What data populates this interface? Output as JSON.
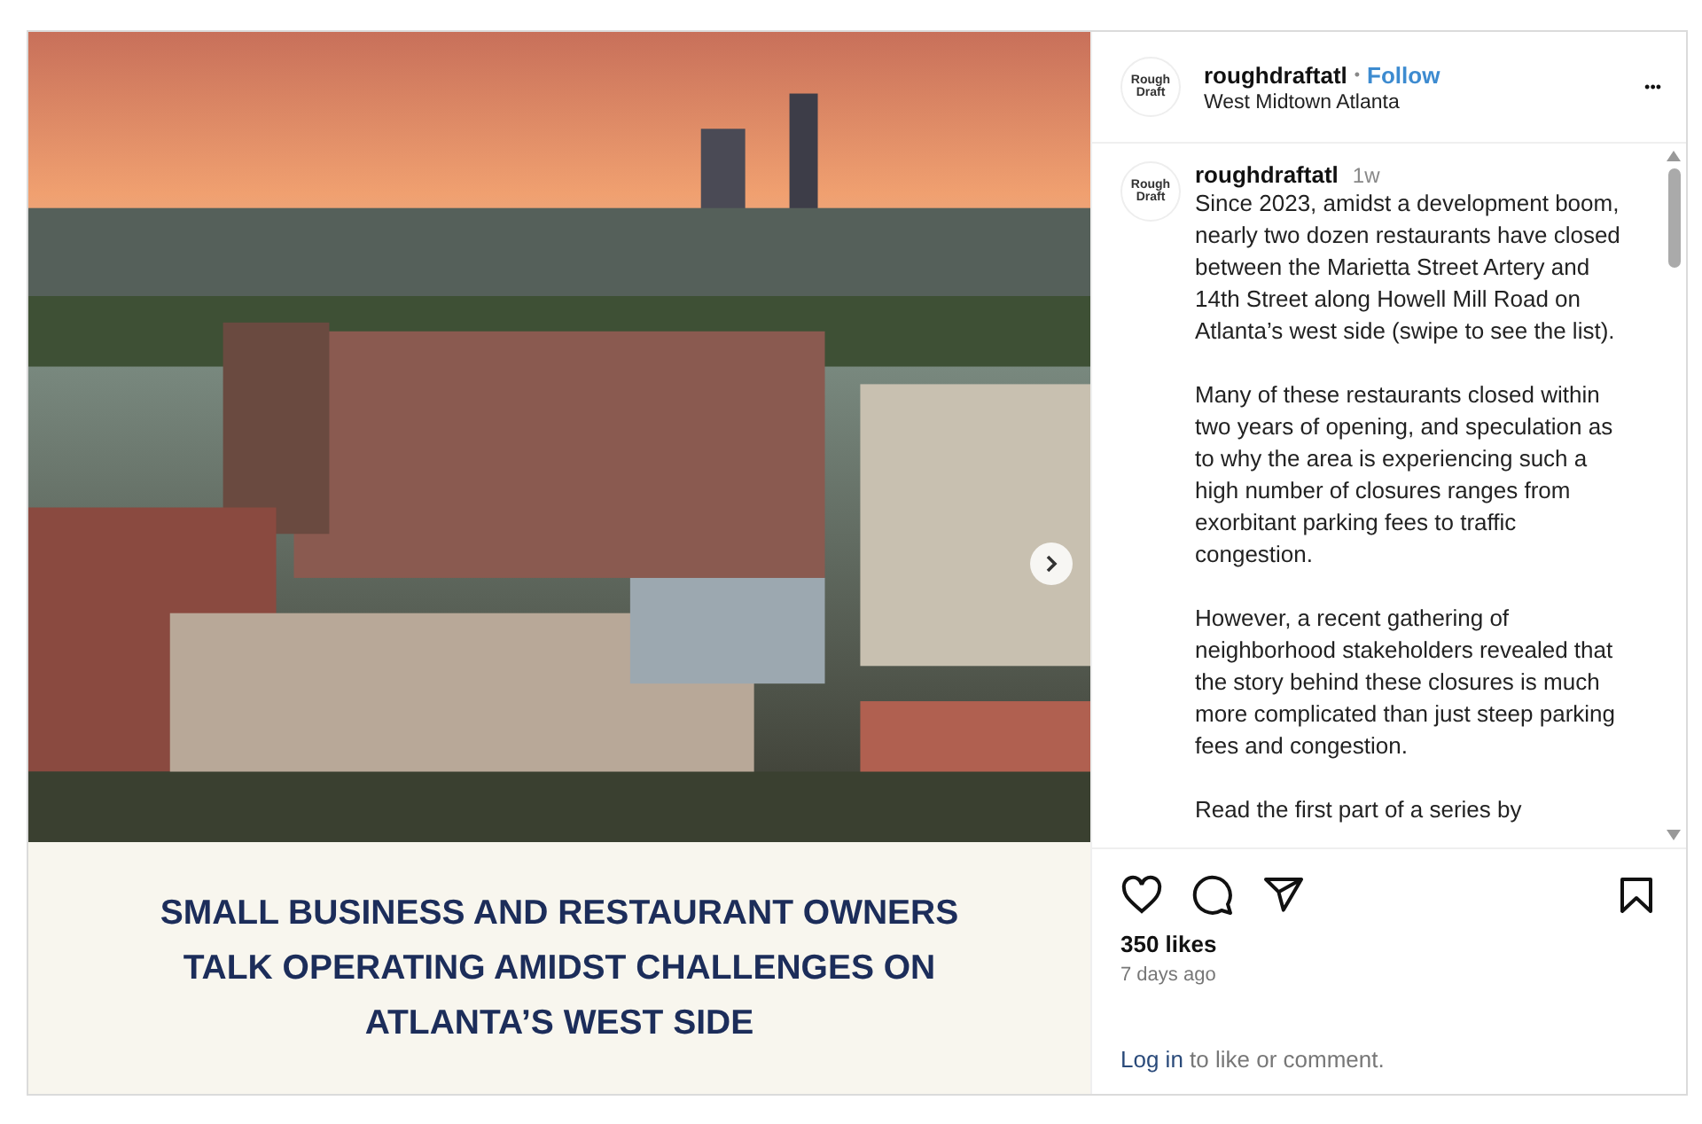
{
  "media": {
    "headline": "SMALL BUSINESS AND RESTAURANT OWNERS TALK OPERATING AMIDST CHALLENGES ON ATLANTA’S WEST SIDE"
  },
  "header": {
    "avatar_lines": [
      "Rough",
      "Draft"
    ],
    "username": "roughdraftatl",
    "separator": "•",
    "follow": "Follow",
    "location": "West Midtown Atlanta",
    "more": "•••"
  },
  "comment": {
    "avatar_lines": [
      "Rough",
      "Draft"
    ],
    "username": "roughdraftatl",
    "age": "1w",
    "paragraphs": [
      "Since 2023, amidst a development boom, nearly two dozen restaurants have closed between the Marietta Street Artery and 14th Street along Howell Mill Road on Atlanta’s west side (swipe to see the list).",
      "Many of these restaurants closed within two years of opening, and speculation as to why the area is experiencing such a high number of closures ranges from exorbitant parking fees to traffic congestion.",
      "However, a recent gathering of neighborhood stakeholders revealed that the story behind these closures is much more complicated than just steep parking fees and congestion.",
      "Read the first part of a series by"
    ]
  },
  "likes": "350 likes",
  "time": "7 days ago",
  "login": {
    "link": "Log in",
    "rest": " to like or comment."
  }
}
